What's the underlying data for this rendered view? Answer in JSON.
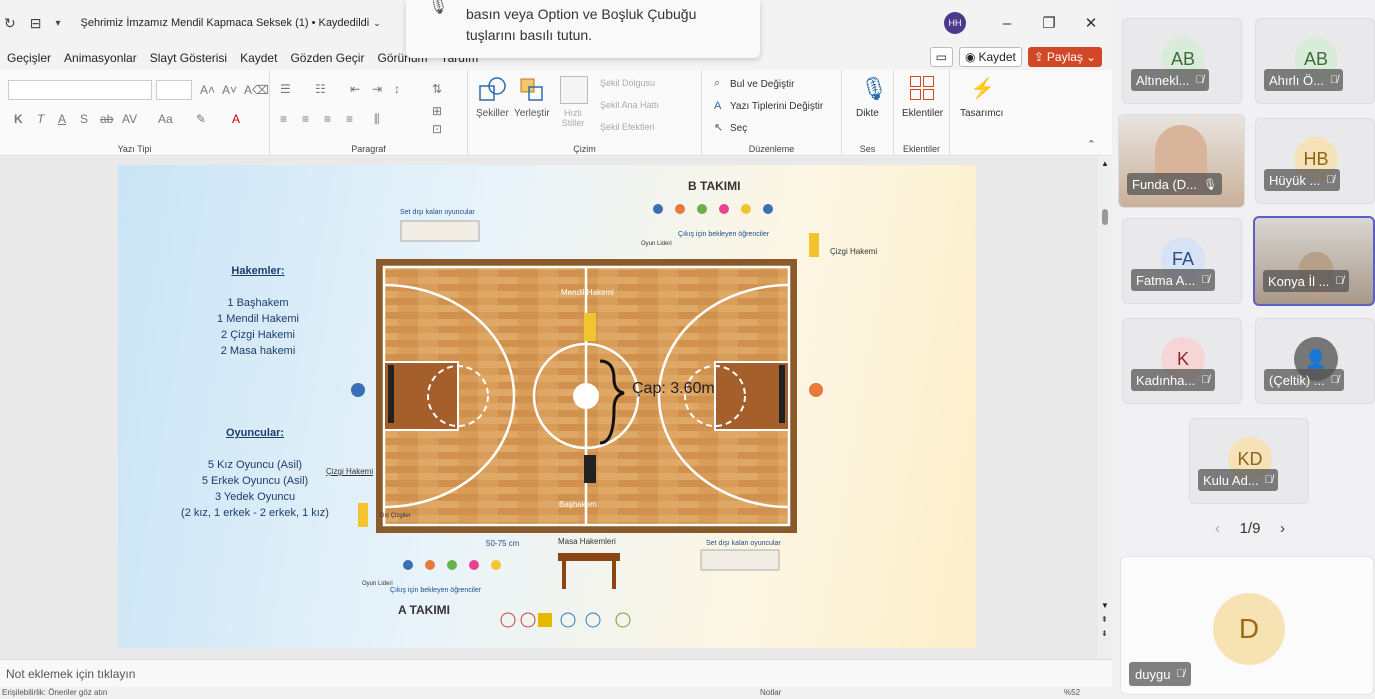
{
  "window": {
    "title": "Şehrimiz İmzamız Mendil Kapmaca Seksek (1) • Kaydedildi",
    "user_initials": "HH"
  },
  "toast": {
    "line1": "basın veya Option ve Boşluk Çubuğu",
    "line2": "tuşlarını basılı tutun."
  },
  "menu": [
    "Geçişler",
    "Animasyonlar",
    "Slayt Gösterisi",
    "Kaydet",
    "Gözden Geçir",
    "Görünüm",
    "Yardım"
  ],
  "menu_right": {
    "record": "Kaydet",
    "share": "Paylaş"
  },
  "ribbon": {
    "groups": {
      "font": "Yazı Tipi",
      "paragraph": "Paragraf",
      "drawing": "Çizim",
      "editing": "Düzenleme",
      "voice": "Ses",
      "addins": "Eklentiler"
    },
    "shapes": "Şekiller",
    "arrange": "Yerleştir",
    "quick_styles": "Hızlı Stiller",
    "shape_fill": "Şekil Dolgusu",
    "shape_outline": "Şekil Ana Hattı",
    "shape_effects": "Şekil Efektleri",
    "find_replace": "Bul ve Değiştir",
    "replace_fonts": "Yazı Tiplerini Değiştir",
    "select": "Seç",
    "dictate": "Dikte",
    "addins_btn": "Eklentiler",
    "designer": "Tasarımcı"
  },
  "slide": {
    "team_b": "B TAKIMI",
    "team_a": "A TAKIMI",
    "referees_title": "Hakemler:",
    "referees": [
      "1 Başhakem",
      "1 Mendil Hakemi",
      "2 Çizgi Hakemi",
      "2 Masa hakemi"
    ],
    "players_title": "Oyuncular:",
    "players": [
      "5 Kız Oyuncu (Asil)",
      "5 Erkek Oyuncu (Asil)",
      "3 Yedek Oyuncu",
      "(2 kız, 1 erkek - 2 erkek, 1 kız)"
    ],
    "bench_top": "Set dışı kalan oyuncular",
    "bench_bottom": "Set dışı kalan oyuncular",
    "waiting_top": "Çıkış için bekleyen öğrenciler",
    "waiting_bottom": "Çıkış için bekleyen öğrenciler",
    "leader_top": "Oyun Lideri",
    "leader_bottom": "Oyun Lideri",
    "line_ref_top": "Çizgi Hakemi",
    "line_ref_left": "Çizgi Hakemi",
    "handkerchief_ref": "Mendil Hakemi",
    "head_ref": "Başhakem",
    "diameter": "Çap: 3.60m",
    "distance": "50-75 cm",
    "table_refs": "Masa Hakemleri",
    "exit_line": "Dış Çizgiler"
  },
  "notes": "Not eklemek için tıklayın",
  "status": {
    "left": "Erişilebilirlik: Öneriler göz atın",
    "notes": "Notlar",
    "zoom": "%52"
  },
  "participants": [
    {
      "initials": "AB",
      "name": "Altınekl...",
      "color": "#d9ecd9"
    },
    {
      "initials": "AB",
      "name": "Ahırlı Ö...",
      "color": "#d9ecd9"
    },
    {
      "initials": "",
      "name": "Funda (D...",
      "color": "#c9a98f"
    },
    {
      "initials": "HB",
      "name": "Hüyük ...",
      "color": "#f6e2b8"
    },
    {
      "initials": "FA",
      "name": "Fatma A...",
      "color": "#d7e3f5"
    },
    {
      "initials": "",
      "name": "Konya İl ...",
      "color": "#b8a898"
    },
    {
      "initials": "K",
      "name": "Kadınha...",
      "color": "#f5d5d5"
    },
    {
      "initials": "",
      "name": "(Çeltik) ...",
      "color": "#777777"
    },
    {
      "initials": "KD",
      "name": "Kulu Ad...",
      "color": "#f6e2b8"
    }
  ],
  "pager": "1/9",
  "featured": {
    "initial": "D",
    "name": "duygu",
    "color": "#f7e2b4"
  }
}
